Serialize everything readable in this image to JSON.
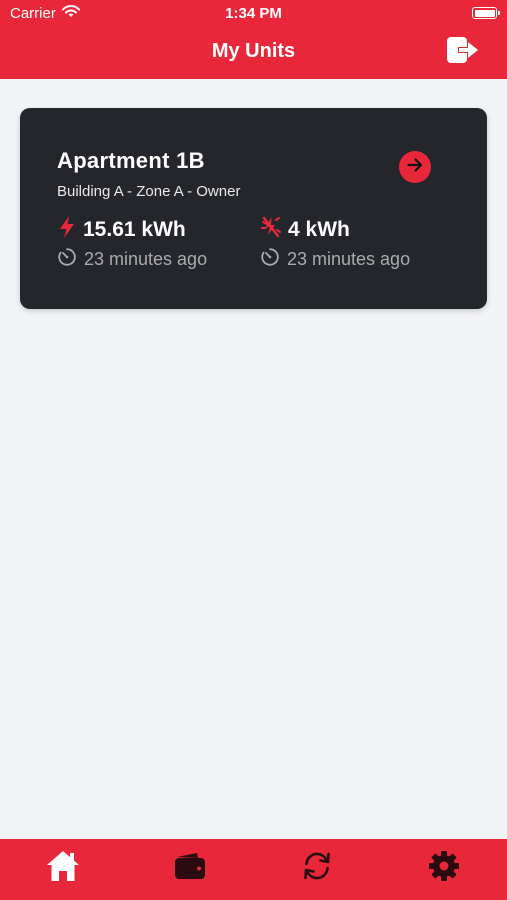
{
  "status_bar": {
    "carrier": "Carrier",
    "time": "1:34 PM"
  },
  "header": {
    "title": "My Units",
    "logout_icon": "logout-icon"
  },
  "unit_card": {
    "name": "Apartment 1B",
    "subtitle": "Building A - Zone A - Owner",
    "consumed": {
      "value": "15.61 kWh",
      "updated": "23 minutes ago",
      "icon": "lightning-icon"
    },
    "produced": {
      "value": "4 kWh",
      "updated": "23 minutes ago",
      "icon": "solar-icon"
    }
  },
  "tabs": [
    {
      "name": "home",
      "icon": "home-icon",
      "active": true
    },
    {
      "name": "wallet",
      "icon": "wallet-icon",
      "active": false
    },
    {
      "name": "sync",
      "icon": "sync-icon",
      "active": false
    },
    {
      "name": "settings",
      "icon": "gear-icon",
      "active": false
    }
  ],
  "colors": {
    "accent": "#e8283a",
    "card": "#25262b",
    "background": "#f3f4f8",
    "tab_active": "#ffffff",
    "tab_inactive": "#2a0c10"
  }
}
